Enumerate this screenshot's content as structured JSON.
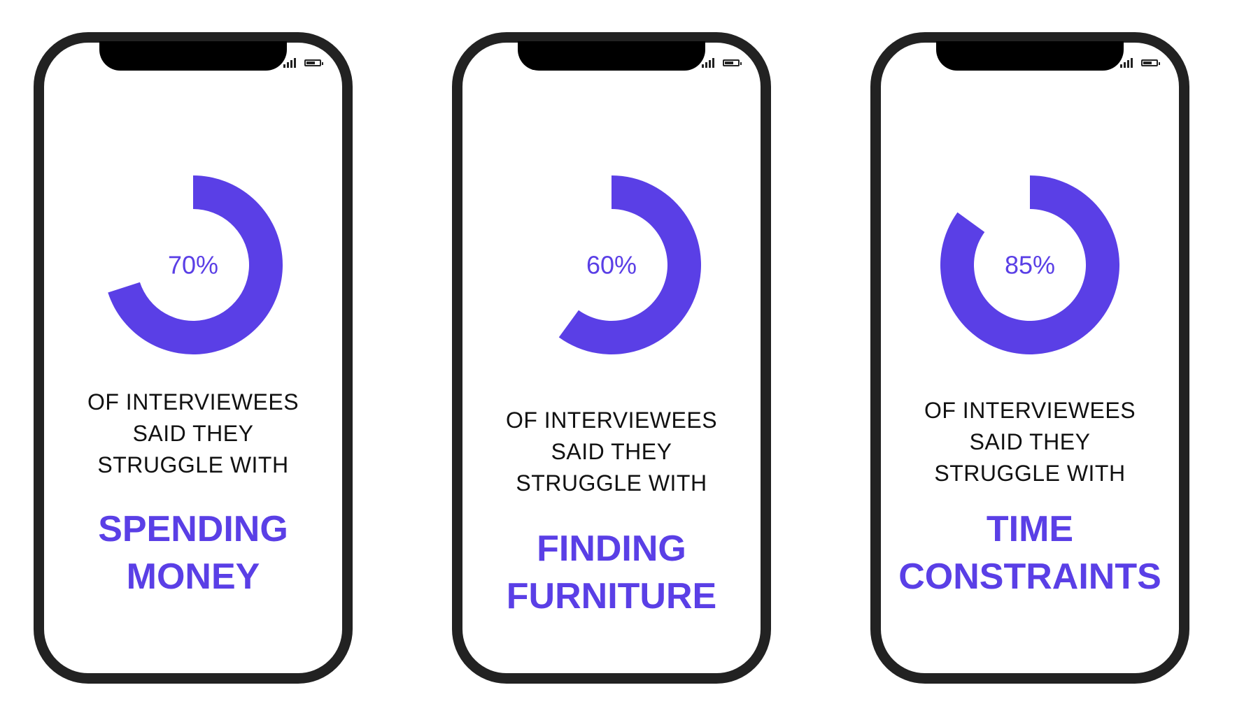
{
  "colors": {
    "accent": "#5a3fe6",
    "phone_frame": "#222222",
    "text": "#111111"
  },
  "icons": [
    "signal-icon",
    "battery-icon"
  ],
  "chart_data": [
    {
      "type": "pie",
      "style": "donut",
      "values": [
        70,
        30
      ],
      "value_label": "70%",
      "description_lines": [
        "OF INTERVIEWEES",
        "SAID THEY",
        "STRUGGLE WITH"
      ],
      "topic_lines": [
        "SPENDING",
        "MONEY"
      ]
    },
    {
      "type": "pie",
      "style": "donut",
      "values": [
        60,
        40
      ],
      "value_label": "60%",
      "description_lines": [
        "OF INTERVIEWEES",
        "SAID THEY",
        "STRUGGLE WITH"
      ],
      "topic_lines": [
        "FINDING",
        "FURNITURE"
      ]
    },
    {
      "type": "pie",
      "style": "donut",
      "values": [
        85,
        15
      ],
      "value_label": "85%",
      "description_lines": [
        "OF INTERVIEWEES",
        "SAID THEY",
        "STRUGGLE WITH"
      ],
      "topic_lines": [
        "TIME",
        "CONSTRAINTS"
      ]
    }
  ]
}
